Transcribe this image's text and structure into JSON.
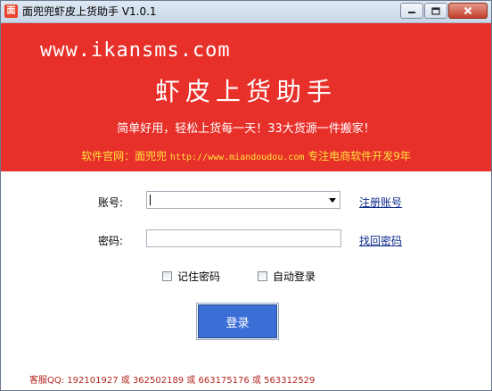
{
  "window": {
    "title": "面兜兜虾皮上货助手 V1.0.1"
  },
  "banner": {
    "site": "www.ikansms.com",
    "title": "虾皮上货助手",
    "slogan": "简单好用，轻松上货每一天！33大货源一件搬家！",
    "footer_prefix": "软件官网：面兜兜",
    "footer_url": "http://www.miandoudou.com",
    "footer_suffix": "专注电商软件开发9年"
  },
  "form": {
    "account_label": "账号:",
    "account_value": "",
    "register_link": "注册账号",
    "password_label": "密码:",
    "password_value": "",
    "recover_link": "找回密码",
    "remember_label": "记住密码",
    "auto_login_label": "自动登录",
    "login_button": "登录"
  },
  "footer": {
    "qq_text": "客服QQ: 192101927 或 362502189 或 663175176 或 563312529"
  },
  "colors": {
    "banner_bg": "#e8302a",
    "banner_footer": "#ffe23b",
    "login_button": "#3c6fd6",
    "qq_text": "#b3261e"
  },
  "icons": {
    "app": "app-logo-icon",
    "minimize": "minimize-icon",
    "maximize": "maximize-icon",
    "close": "close-icon",
    "dropdown": "chevron-down-icon"
  }
}
